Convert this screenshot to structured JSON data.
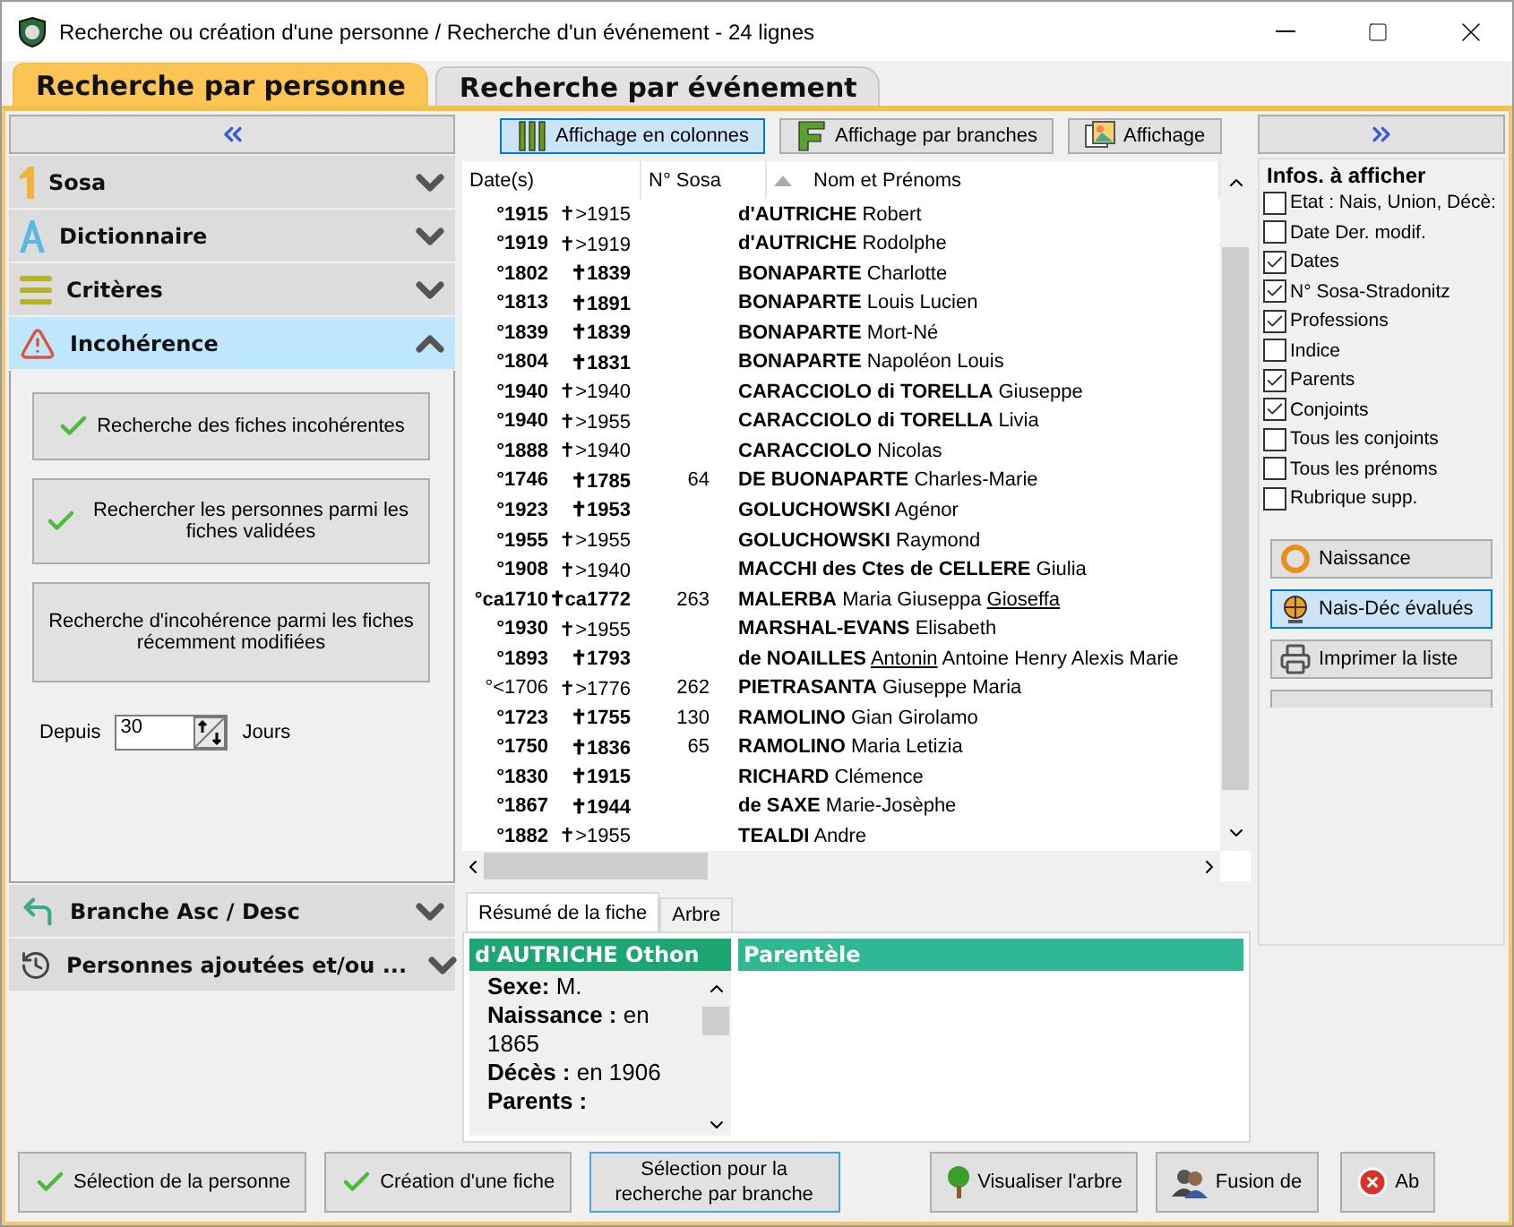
{
  "window": {
    "title": "Recherche ou création d'une personne / Recherche d'un événement - 24 lignes"
  },
  "tabs": [
    {
      "label": "Recherche par personne",
      "selected": true
    },
    {
      "label": "Recherche par événement",
      "selected": false
    }
  ],
  "left_panel": {
    "sections": [
      {
        "kind": "sosa",
        "label": "Sosa",
        "expanded": false
      },
      {
        "kind": "dictionary",
        "label": "Dictionnaire",
        "expanded": false
      },
      {
        "kind": "criteria",
        "label": "Critères",
        "expanded": false
      },
      {
        "kind": "warning",
        "label": "Incohérence",
        "expanded": true,
        "buttons": [
          {
            "label": "Recherche des fiches incohérentes",
            "check": true
          },
          {
            "label": "Rechercher les personnes parmi les fiches validées",
            "check": true
          },
          {
            "label": "Recherche d'incohérence parmi les fiches récemment modifiées",
            "check": false
          }
        ],
        "since_label": "Depuis",
        "since_value": "30",
        "days_label": "Jours"
      },
      {
        "kind": "branch",
        "label": "Branche Asc / Desc",
        "expanded": false
      },
      {
        "kind": "history",
        "label": "Personnes ajoutées et/ou ...",
        "expanded": false
      }
    ]
  },
  "view_buttons": [
    {
      "kind": "columns",
      "label": "Affichage en colonnes",
      "selected": true
    },
    {
      "kind": "branches",
      "label": "Affichage par branches",
      "selected": false
    },
    {
      "kind": "picture",
      "label": "Affichage",
      "selected": false
    }
  ],
  "table": {
    "columns": [
      "Date(s)",
      "N° Sosa",
      "Nom et Prénoms"
    ],
    "rows": [
      {
        "birth": "°1915",
        "birth_exact": true,
        "death": "✝>1915",
        "death_exact": false,
        "sosa": "",
        "surname": "d'AUTRICHE",
        "given": [
          {
            "text": "Robert",
            "underlined": false
          }
        ]
      },
      {
        "birth": "°1919",
        "birth_exact": true,
        "death": "✝>1919",
        "death_exact": false,
        "sosa": "",
        "surname": "d'AUTRICHE",
        "given": [
          {
            "text": "Rodolphe",
            "underlined": false
          }
        ]
      },
      {
        "birth": "°1802",
        "birth_exact": true,
        "death": "✝1839",
        "death_exact": true,
        "sosa": "",
        "surname": "BONAPARTE",
        "given": [
          {
            "text": "Charlotte",
            "underlined": false
          }
        ]
      },
      {
        "birth": "°1813",
        "birth_exact": true,
        "death": "✝1891",
        "death_exact": true,
        "sosa": "",
        "surname": "BONAPARTE",
        "given": [
          {
            "text": "Louis Lucien",
            "underlined": false
          }
        ]
      },
      {
        "birth": "°1839",
        "birth_exact": true,
        "death": "✝1839",
        "death_exact": true,
        "sosa": "",
        "surname": "BONAPARTE",
        "given": [
          {
            "text": "Mort-Né",
            "underlined": false
          }
        ]
      },
      {
        "birth": "°1804",
        "birth_exact": true,
        "death": "✝1831",
        "death_exact": true,
        "sosa": "",
        "surname": "BONAPARTE",
        "given": [
          {
            "text": "Napoléon Louis",
            "underlined": false
          }
        ]
      },
      {
        "birth": "°1940",
        "birth_exact": true,
        "death": "✝>1940",
        "death_exact": false,
        "sosa": "",
        "surname": "CARACCIOLO di TORELLA",
        "given": [
          {
            "text": "Giuseppe",
            "underlined": false
          }
        ]
      },
      {
        "birth": "°1940",
        "birth_exact": true,
        "death": "✝>1955",
        "death_exact": false,
        "sosa": "",
        "surname": "CARACCIOLO di TORELLA",
        "given": [
          {
            "text": "Livia",
            "underlined": false
          }
        ]
      },
      {
        "birth": "°1888",
        "birth_exact": true,
        "death": "✝>1940",
        "death_exact": false,
        "sosa": "",
        "surname": "CARACCIOLO",
        "given": [
          {
            "text": "Nicolas",
            "underlined": false
          }
        ]
      },
      {
        "birth": "°1746",
        "birth_exact": true,
        "death": "✝1785",
        "death_exact": true,
        "sosa": "64",
        "surname": "DE BUONAPARTE",
        "given": [
          {
            "text": "Charles-Marie",
            "underlined": false
          }
        ]
      },
      {
        "birth": "°1923",
        "birth_exact": true,
        "death": "✝1953",
        "death_exact": true,
        "sosa": "",
        "surname": "GOLUCHOWSKI",
        "given": [
          {
            "text": "Agénor",
            "underlined": false
          }
        ]
      },
      {
        "birth": "°1955",
        "birth_exact": true,
        "death": "✝>1955",
        "death_exact": false,
        "sosa": "",
        "surname": "GOLUCHOWSKI",
        "given": [
          {
            "text": "Raymond",
            "underlined": false
          }
        ]
      },
      {
        "birth": "°1908",
        "birth_exact": true,
        "death": "✝>1940",
        "death_exact": false,
        "sosa": "",
        "surname": "MACCHI des Ctes de CELLERE",
        "given": [
          {
            "text": "Giulia",
            "underlined": false
          }
        ]
      },
      {
        "birth": "°ca1710",
        "birth_exact": true,
        "death": "✝ca1772",
        "death_exact": true,
        "sosa": "263",
        "surname": "MALERBA",
        "given": [
          {
            "text": "Maria Giuseppa",
            "underlined": false
          },
          {
            "text": "Gioseffa",
            "underlined": true
          }
        ]
      },
      {
        "birth": "°1930",
        "birth_exact": true,
        "death": "✝>1955",
        "death_exact": false,
        "sosa": "",
        "surname": "MARSHAL-EVANS",
        "given": [
          {
            "text": "Elisabeth",
            "underlined": false
          }
        ]
      },
      {
        "birth": "°1893",
        "birth_exact": true,
        "death": "✝1793",
        "death_exact": true,
        "sosa": "",
        "surname": "de NOAILLES",
        "given": [
          {
            "text": "Antonin",
            "underlined": true
          },
          {
            "text": "Antoine Henry Alexis Marie",
            "underlined": false
          }
        ]
      },
      {
        "birth": "°<1706",
        "birth_exact": false,
        "death": "✝>1776",
        "death_exact": false,
        "sosa": "262",
        "surname": "PIETRASANTA",
        "given": [
          {
            "text": "Giuseppe Maria",
            "underlined": false
          }
        ]
      },
      {
        "birth": "°1723",
        "birth_exact": true,
        "death": "✝1755",
        "death_exact": true,
        "sosa": "130",
        "surname": "RAMOLINO",
        "given": [
          {
            "text": "Gian Girolamo",
            "underlined": false
          }
        ]
      },
      {
        "birth": "°1750",
        "birth_exact": true,
        "death": "✝1836",
        "death_exact": true,
        "sosa": "65",
        "surname": "RAMOLINO",
        "given": [
          {
            "text": "Maria Letizia",
            "underlined": false
          }
        ]
      },
      {
        "birth": "°1830",
        "birth_exact": true,
        "death": "✝1915",
        "death_exact": true,
        "sosa": "",
        "surname": "RICHARD",
        "given": [
          {
            "text": "Clémence",
            "underlined": false
          }
        ]
      },
      {
        "birth": "°1867",
        "birth_exact": true,
        "death": "✝1944",
        "death_exact": true,
        "sosa": "",
        "surname": "de SAXE",
        "given": [
          {
            "text": "Marie-Josèphe",
            "underlined": false
          }
        ]
      },
      {
        "birth": "°1882",
        "birth_exact": true,
        "death": "✝>1955",
        "death_exact": false,
        "sosa": "",
        "surname": "TEALDI",
        "given": [
          {
            "text": "Andre",
            "underlined": false
          }
        ]
      }
    ]
  },
  "detail_tabs": [
    {
      "label": "Résumé de la fiche",
      "selected": true
    },
    {
      "label": "Arbre",
      "selected": false
    }
  ],
  "summary": {
    "title": "d'AUTRICHE Othon",
    "fields": [
      {
        "label": "Sexe:",
        "value": "M."
      },
      {
        "label": "Naissance :",
        "value": "en 1865"
      },
      {
        "label": "Décès :",
        "value": "en 1906"
      },
      {
        "label": "Parents :"
      }
    ]
  },
  "kinship": {
    "title": "Parentèle"
  },
  "infos": {
    "title": "Infos. à afficher",
    "options": [
      {
        "label": "Etat : Nais, Union, Décè:",
        "checked": false
      },
      {
        "label": "Date Der. modif.",
        "checked": false
      },
      {
        "label": "Dates",
        "checked": true
      },
      {
        "label": "N° Sosa-Stradonitz",
        "checked": true
      },
      {
        "label": "Professions",
        "checked": true
      },
      {
        "label": "Indice",
        "checked": false
      },
      {
        "label": "Parents",
        "checked": true
      },
      {
        "label": "Conjoints",
        "checked": true
      },
      {
        "label": "Tous les conjoints",
        "checked": false
      },
      {
        "label": "Tous les prénoms",
        "checked": false
      },
      {
        "label": "Rubrique supp.",
        "checked": false
      }
    ]
  },
  "side_buttons": [
    {
      "kind": "ring",
      "label": "Naissance",
      "selected": false
    },
    {
      "kind": "globe",
      "label": "Nais-Déc évalués",
      "selected": true
    },
    {
      "kind": "printer",
      "label": "Imprimer la liste",
      "selected": false
    }
  ],
  "bottom_buttons": [
    {
      "kind": "check",
      "label": "Sélection de la personne",
      "focused": false
    },
    {
      "kind": "check",
      "label": "Création d'une fiche",
      "focused": false
    },
    {
      "kind": "plain",
      "label": "Sélection pour la recherche par branche",
      "focused": true
    },
    {
      "kind": "tree",
      "label": "Visualiser l'arbre",
      "focused": false
    },
    {
      "kind": "people",
      "label": "Fusion de",
      "focused": false
    },
    {
      "kind": "cancel",
      "label": "Ab",
      "focused": false
    }
  ]
}
